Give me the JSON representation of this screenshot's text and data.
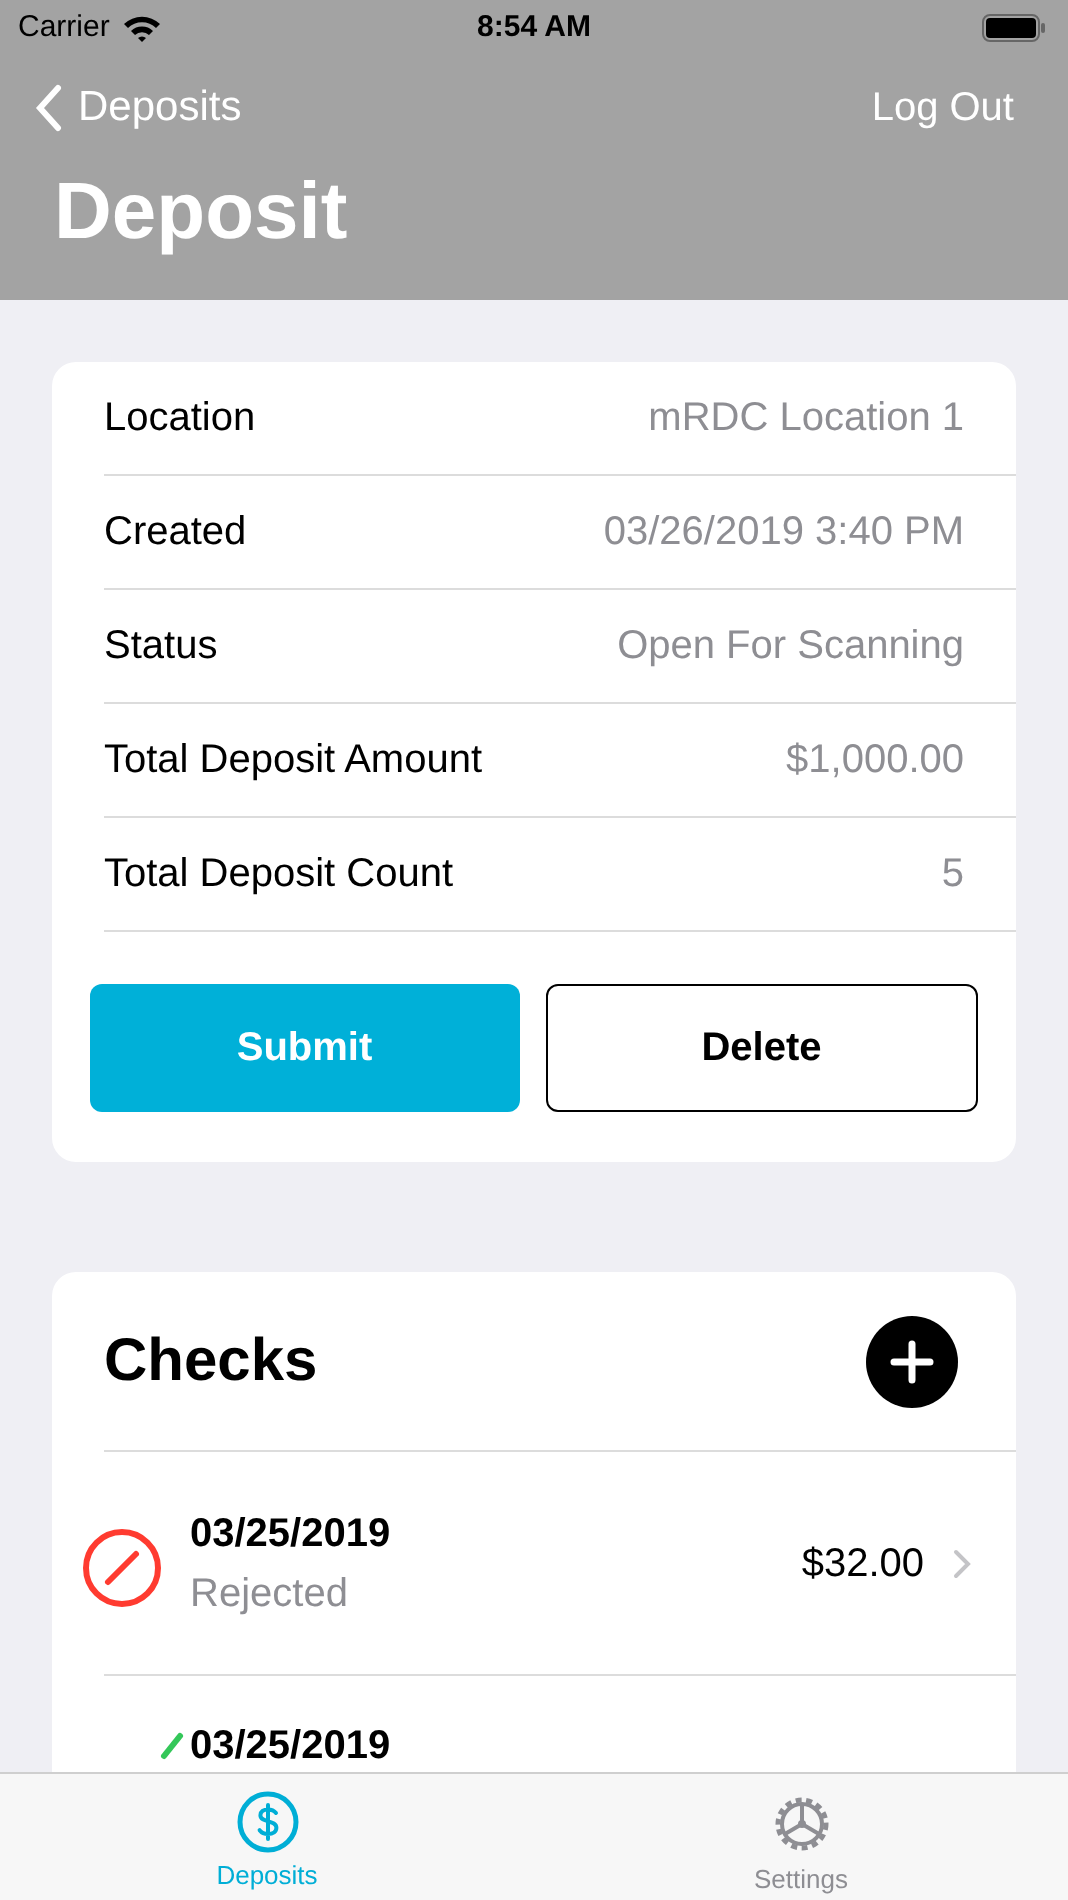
{
  "status_bar": {
    "carrier": "Carrier",
    "time": "8:54 AM"
  },
  "nav": {
    "back": "Deposits",
    "action": "Log Out",
    "title": "Deposit"
  },
  "details": [
    {
      "label": "Location",
      "value": "mRDC Location 1"
    },
    {
      "label": "Created",
      "value": "03/26/2019 3:40 PM"
    },
    {
      "label": "Status",
      "value": "Open For Scanning"
    },
    {
      "label": "Total Deposit Amount",
      "value": "$1,000.00"
    },
    {
      "label": "Total Deposit Count",
      "value": "5"
    }
  ],
  "buttons": [
    {
      "kind": "primary",
      "label": "Submit"
    },
    {
      "kind": "outline",
      "label": "Delete"
    }
  ],
  "checks": {
    "title": "Checks",
    "items": [
      {
        "kind": "rejected",
        "date": "03/25/2019",
        "status": "Rejected",
        "amount": "$32.00"
      },
      {
        "kind": "accepted",
        "date": "03/25/2019"
      }
    ]
  },
  "tab_bar": [
    {
      "kind": "deposits",
      "label": "Deposits",
      "selected": true
    },
    {
      "kind": "settings",
      "label": "Settings",
      "selected": false
    }
  ]
}
